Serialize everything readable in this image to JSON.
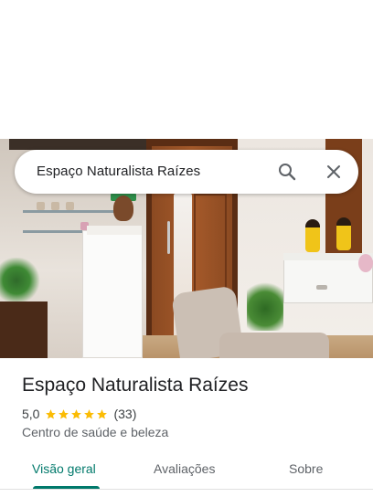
{
  "search": {
    "query": "Espaço Naturalista Raízes",
    "search_icon": "search-icon",
    "close_icon": "close-icon"
  },
  "place": {
    "name": "Espaço Naturalista Raízes",
    "rating": "5,0",
    "rating_stars": 5,
    "review_count": "(33)",
    "category": "Centro de saúde e beleza"
  },
  "tabs": [
    {
      "label": "Visão geral",
      "active": true
    },
    {
      "label": "Avaliações",
      "active": false
    },
    {
      "label": "Sobre",
      "active": false
    }
  ],
  "colors": {
    "accent": "#00796b",
    "star": "#fbbc04",
    "text_primary": "#202124",
    "text_secondary": "#5f6368"
  }
}
